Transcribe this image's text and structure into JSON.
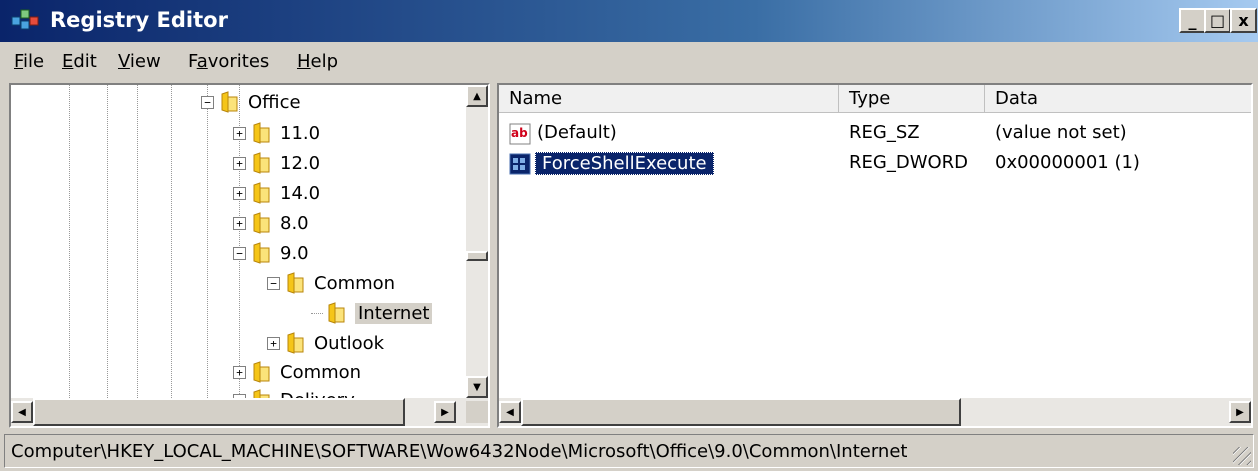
{
  "window": {
    "title": "Registry Editor",
    "controls": {
      "minimize": "_",
      "maximize": "□",
      "close": "x"
    }
  },
  "menu": [
    {
      "pre": "",
      "u": "F",
      "post": "ile"
    },
    {
      "pre": "",
      "u": "E",
      "post": "dit"
    },
    {
      "pre": "",
      "u": "V",
      "post": "iew"
    },
    {
      "pre": "F",
      "u": "a",
      "post": "vorites"
    },
    {
      "pre": "",
      "u": "H",
      "post": "elp"
    }
  ],
  "tree": {
    "items": [
      {
        "label": "Office",
        "expander": "−",
        "selected": false
      },
      {
        "label": "11.0",
        "expander": "+",
        "selected": false
      },
      {
        "label": "12.0",
        "expander": "+",
        "selected": false
      },
      {
        "label": "14.0",
        "expander": "+",
        "selected": false
      },
      {
        "label": "8.0",
        "expander": "+",
        "selected": false
      },
      {
        "label": "9.0",
        "expander": "−",
        "selected": false
      },
      {
        "label": "Common",
        "expander": "−",
        "selected": false
      },
      {
        "label": "Internet",
        "expander": "",
        "selected": true
      },
      {
        "label": "Outlook",
        "expander": "+",
        "selected": false
      },
      {
        "label": "Common",
        "expander": "+",
        "selected": false
      },
      {
        "label": "Delivery",
        "expander": "+",
        "selected": false
      }
    ]
  },
  "list": {
    "columns": [
      "Name",
      "Type",
      "Data"
    ],
    "rows": [
      {
        "icon": "string-value-icon",
        "icon_text": "ab",
        "name": "(Default)",
        "type": "REG_SZ",
        "data": "(value not set)",
        "selected": false
      },
      {
        "icon": "binary-value-icon",
        "icon_text": "",
        "name": "ForceShellExecute",
        "type": "REG_DWORD",
        "data": "0x00000001 (1)",
        "selected": true
      }
    ]
  },
  "status": {
    "path": "Computer\\HKEY_LOCAL_MACHINE\\SOFTWARE\\Wow6432Node\\Microsoft\\Office\\9.0\\Common\\Internet"
  },
  "colors": {
    "title_start": "#0a246a",
    "selection": "#0a246a",
    "folder": "#f5c518"
  }
}
